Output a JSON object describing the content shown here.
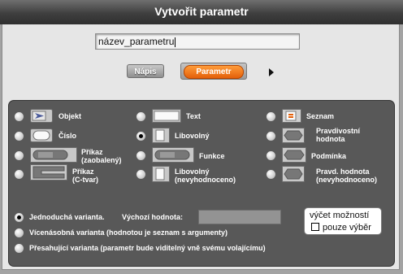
{
  "dialog": {
    "title": "Vytvořit parametr"
  },
  "name_field": {
    "value": "název_parametru"
  },
  "categories": {
    "napis": "Nápis",
    "parametr": "Parametr"
  },
  "types": {
    "objekt": "Objekt",
    "text": "Text",
    "seznam": "Seznam",
    "cislo": "Číslo",
    "libovolny": "Libovolný",
    "pravdivostni_l1": "Pravdivostní",
    "pravdivostni_l2": "hodnota",
    "prikaz_zab_l1": "Příkaz",
    "prikaz_zab_l2": "(zaobalený)",
    "funkce": "Funkce",
    "podminka": "Podmínka",
    "prikaz_c_l1": "Příkaz",
    "prikaz_c_l2": "(C-tvar)",
    "libovolny_nev_l1": "Libovolný",
    "libovolny_nev_l2": "(nevyhodnoceno)",
    "pravd_nev_l1": "Pravd. hodnota",
    "pravd_nev_l2": "(nevyhodnoceno)"
  },
  "variants": {
    "single": "Jednoduchá varianta.",
    "default_label": "Výchozí hodnota:",
    "multi": "Vícenásobná varianta (hodnotou je seznam s argumenty)",
    "upvar": "Přesahující varianta (parametr bude viditelný vně svému volajícímu)"
  },
  "options": {
    "line1": "výčet možností",
    "line2": "pouze výběr"
  },
  "selected_type": "libovolny",
  "selected_variant": "single",
  "colors": {
    "accent": "#e4600a",
    "panel": "#585858"
  }
}
